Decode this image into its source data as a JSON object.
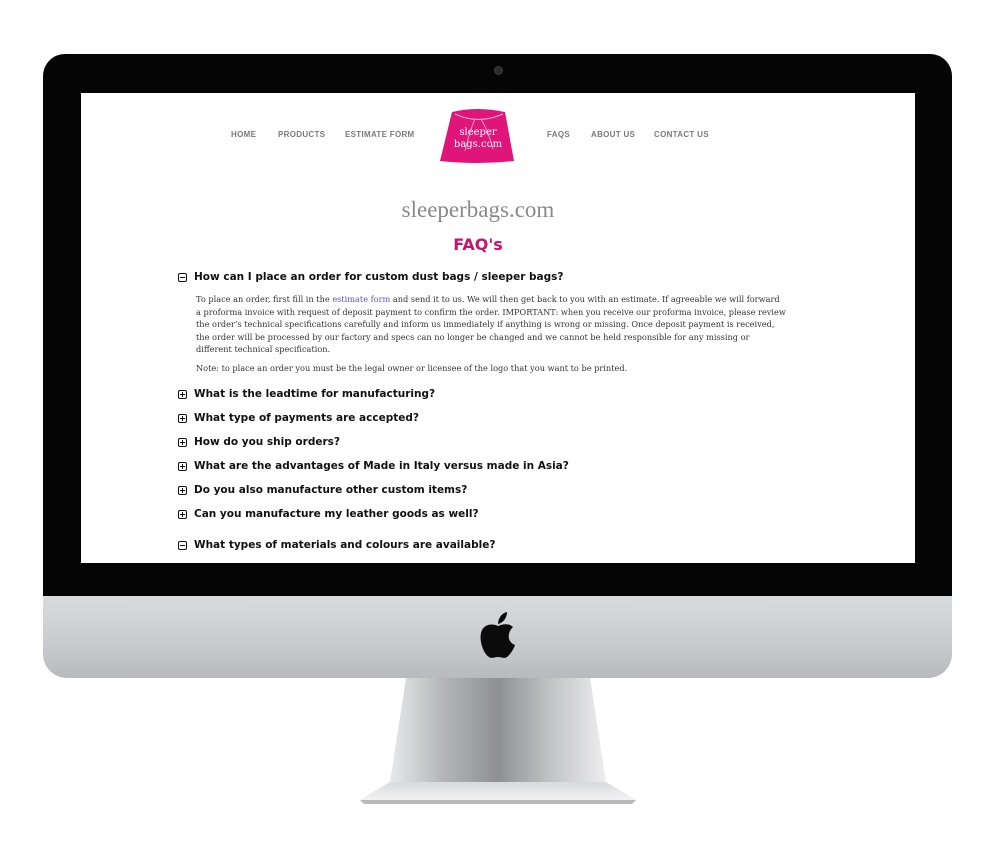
{
  "nav": {
    "home": "HOME",
    "products": "PRODUCTS",
    "estimate_form": "ESTIMATE FORM",
    "faqs": "FAQS",
    "about_us": "ABOUT US",
    "contact_us": "CONTACT US"
  },
  "logo": {
    "line1": "sleeper",
    "line2": "bags.com",
    "color": "#e0157a"
  },
  "site_title": "sleeperbags.com",
  "faq_title": "FAQ's",
  "faqs": [
    {
      "question": "How can I place an order for custom dust bags / sleeper bags?",
      "expanded": true
    },
    {
      "question": "What is the leadtime for manufacturing?",
      "expanded": false
    },
    {
      "question": "What type of payments are accepted?",
      "expanded": false
    },
    {
      "question": "How do you ship orders?",
      "expanded": false
    },
    {
      "question": "What are the advantages of Made in Italy versus made in Asia?",
      "expanded": false
    },
    {
      "question": "Do you also manufacture other custom items?",
      "expanded": false
    },
    {
      "question": "Can you manufacture my leather goods as well?",
      "expanded": false
    },
    {
      "question": "What types of materials and colours are available?",
      "expanded": true
    }
  ],
  "answer1": {
    "before_link": "To place an order, first fill in the ",
    "link_text": "estimate form",
    "after_link": " and send it to us. We will then get back to you with an estimate. If agreeable we will forward a proforma invoice with request of deposit payment to confirm the order. IMPORTANT: when you receive our proforma invoice, please review the order’s technical specifications carefully and inform us immediately if anything is wrong or missing. Once deposit payment is received, the order will be processed by our factory and specs can no longer be changed and we cannot be held responsible for any missing or different technical specification.",
    "note": "Note: to place an order you must be the legal owner or licensee of the logo that you want to be printed."
  }
}
